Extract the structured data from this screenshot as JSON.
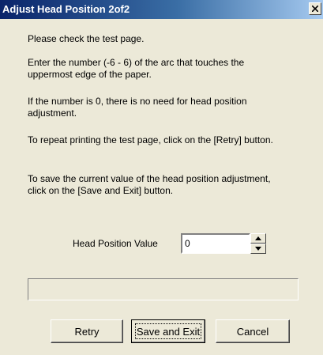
{
  "window": {
    "title": "Adjust Head Position 2of2"
  },
  "messages": [
    "Please check the test page.",
    "Enter the number (-6 - 6) of the arc that touches the uppermost edge of the paper.",
    "If the number is 0, there is no need for head position adjustment.",
    "To repeat printing the test page, click on the [Retry] button.",
    "To save the current value of the head position adjustment, click on the [Save and Exit] button."
  ],
  "head_position": {
    "label": "Head Position Value",
    "value": "0"
  },
  "progress": {
    "fraction": 0
  },
  "buttons": {
    "retry": "Retry",
    "save_exit": "Save and Exit",
    "cancel": "Cancel"
  },
  "icons": {
    "close": "close-icon",
    "spin_up": "triangle-up-icon",
    "spin_down": "triangle-down-icon"
  },
  "colors": {
    "title_start": "#0a246a",
    "title_end": "#a6caf0",
    "dialog_bg": "#ece9d8"
  }
}
